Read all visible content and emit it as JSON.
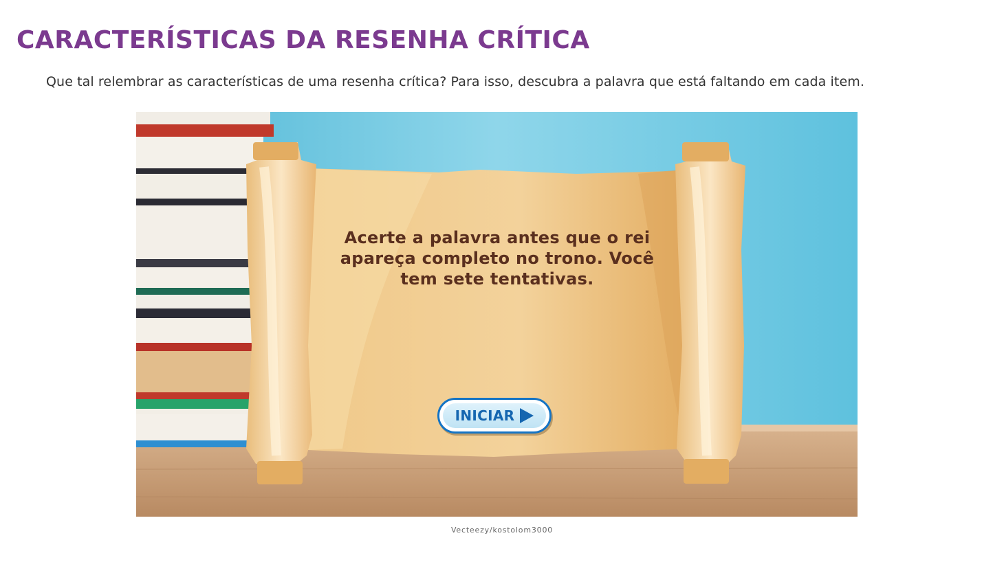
{
  "page": {
    "title": "CARACTERÍSTICAS DA RESENHA CRÍTICA",
    "intro": "Que tal relembrar as características de uma resenha crítica? Para isso, descubra a palavra que está faltando em cada item."
  },
  "game": {
    "instructions": "Acerte a palavra antes que o rei apareça completo no trono. Você tem sete tentativas.",
    "start_label": "INICIAR",
    "start_icon": "play-icon"
  },
  "image_credit": "Vecteezy/kostolom3000",
  "colors": {
    "title": "#7b3a8f",
    "background_sky": "#6ecbe3",
    "parchment": "#f2cd8e",
    "instruction_text": "#5a2f1e",
    "button_blue": "#1566b0"
  }
}
